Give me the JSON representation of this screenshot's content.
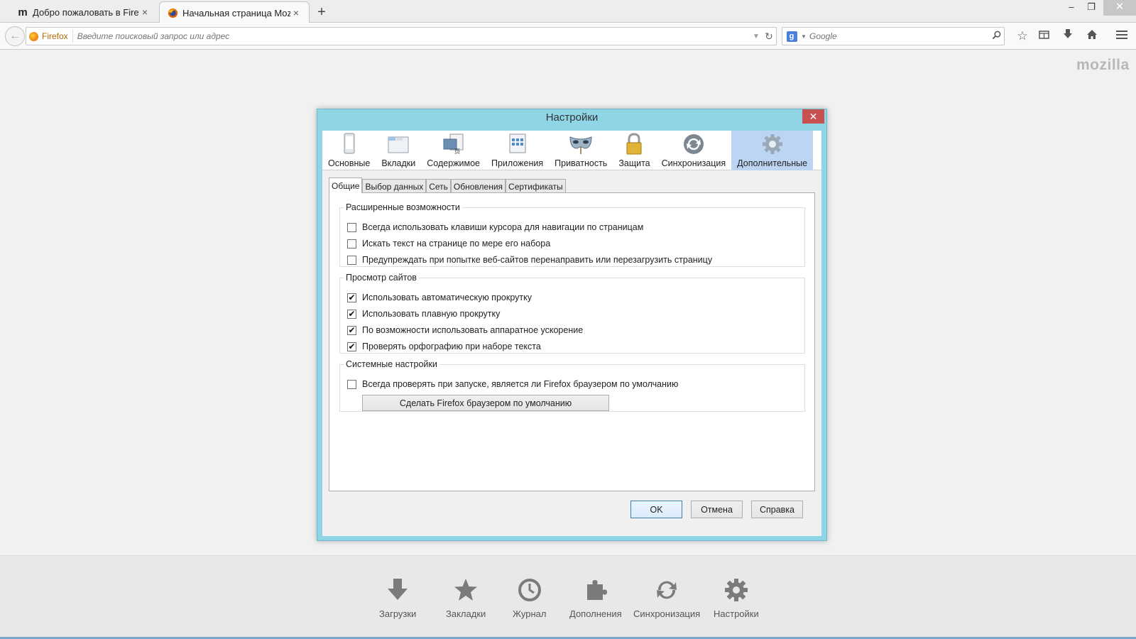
{
  "tabs": [
    {
      "label": "Добро пожаловать в Firefox",
      "icon": "mozilla-m-icon"
    },
    {
      "label": "Начальная страница Mozi...",
      "icon": "firefox-icon"
    }
  ],
  "close_glyph": "×",
  "new_tab_glyph": "+",
  "window_controls": {
    "minimize": "–",
    "maximize": "❐",
    "close": "✕"
  },
  "navbar": {
    "identity_label": "Firefox",
    "url_placeholder": "Введите поисковый запрос или адрес",
    "search_placeholder": "Google",
    "search_engine_letter": "g"
  },
  "brand": "mozilla",
  "dialog": {
    "title": "Настройки",
    "close_glyph": "✕",
    "panes": [
      {
        "label": "Основные",
        "icon": "phone-icon"
      },
      {
        "label": "Вкладки",
        "icon": "tabs-window-icon"
      },
      {
        "label": "Содержимое",
        "icon": "content-icon"
      },
      {
        "label": "Приложения",
        "icon": "applications-icon"
      },
      {
        "label": "Приватность",
        "icon": "mask-icon"
      },
      {
        "label": "Защита",
        "icon": "padlock-icon"
      },
      {
        "label": "Синхронизация",
        "icon": "sync-icon"
      },
      {
        "label": "Дополнительные",
        "icon": "gear-icon"
      }
    ],
    "selected_pane": "Дополнительные",
    "subtabs": [
      "Общие",
      "Выбор данных",
      "Сеть",
      "Обновления",
      "Сертификаты"
    ],
    "active_subtab": "Общие",
    "groups": {
      "accessibility": {
        "legend": "Расширенные возможности",
        "options": [
          {
            "label": "Всегда использовать клавиши курсора для навигации по страницам",
            "checked": false
          },
          {
            "label": "Искать текст на странице по мере его набора",
            "checked": false
          },
          {
            "label": "Предупреждать при попытке веб-сайтов перенаправить или перезагрузить страницу",
            "checked": false
          }
        ]
      },
      "browsing": {
        "legend": "Просмотр сайтов",
        "options": [
          {
            "label": "Использовать автоматическую прокрутку",
            "checked": true
          },
          {
            "label": "Использовать плавную прокрутку",
            "checked": true
          },
          {
            "label": "По возможности использовать аппаратное ускорение",
            "checked": true
          },
          {
            "label": "Проверять орфографию при наборе текста",
            "checked": true
          }
        ]
      },
      "system": {
        "legend": "Системные настройки",
        "options": [
          {
            "label": "Всегда проверять при запуске, является ли Firefox браузером по умолчанию",
            "checked": false
          }
        ],
        "button_label": "Сделать Firefox браузером по умолчанию"
      }
    },
    "check_glyph": "✔",
    "buttons": {
      "ok": "OK",
      "cancel": "Отмена",
      "help": "Справка"
    }
  },
  "launcher": [
    {
      "label": "Загрузки",
      "icon": "download-arrow-icon"
    },
    {
      "label": "Закладки",
      "icon": "star-icon"
    },
    {
      "label": "Журнал",
      "icon": "clock-icon"
    },
    {
      "label": "Дополнения",
      "icon": "puzzle-icon"
    },
    {
      "label": "Синхронизация",
      "icon": "sync-icon"
    },
    {
      "label": "Настройки",
      "icon": "gear-icon"
    }
  ],
  "colors": {
    "dialog_frame": "#8fd5e6",
    "selected_pane": "#bcd5f2",
    "close_red": "#c75050",
    "launcher_icon": "#7b7b7b"
  }
}
